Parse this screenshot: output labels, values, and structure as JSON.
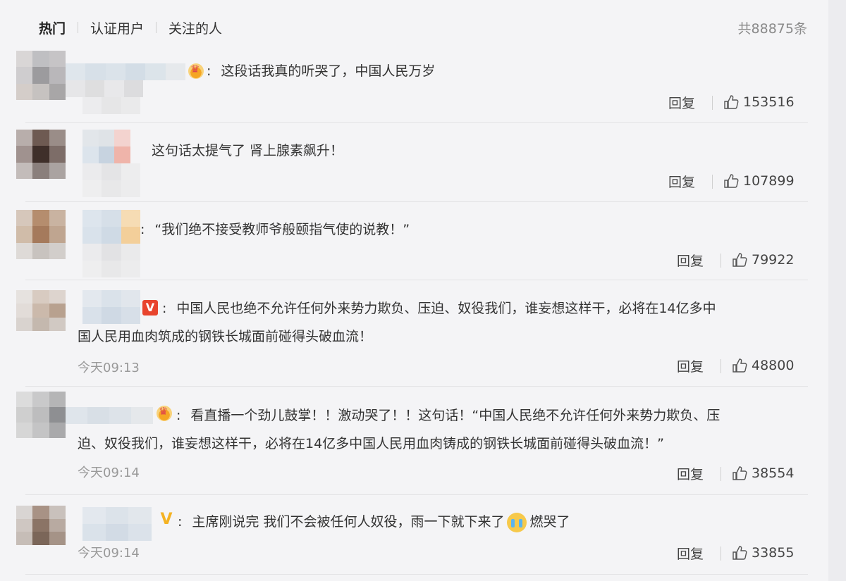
{
  "tabs": [
    {
      "label": "热门",
      "active": true
    },
    {
      "label": "认证用户",
      "active": false
    },
    {
      "label": "关注的人",
      "active": false
    }
  ],
  "total_count": "共88875条",
  "reply_label": "回复",
  "comments": [
    {
      "text": "这段话我真的听哭了，中国人民万岁",
      "badge": "crown",
      "likes": "153516",
      "time": ""
    },
    {
      "text": "这句话太提气了 肾上腺素飙升！",
      "badge": "none",
      "likes": "107899",
      "time": ""
    },
    {
      "text": "“我们绝不接受教师爷般颐指气使的说教！”",
      "badge": "crown",
      "likes": "79922",
      "time": ""
    },
    {
      "text_line1": "中国人民也绝不允许任何外来势力欺负、压迫、奴役我们，谁妄想这样干，必将在14亿多中",
      "text_line2": "国人民用血肉筑成的钢铁长城面前碰得头破血流！",
      "badge": "v-red",
      "likes": "48800",
      "time": "今天09:13"
    },
    {
      "text_line1": "看直播一个劲儿鼓掌！！激动哭了！！这句话！“中国人民绝不允许任何外来势力欺负、压",
      "text_line2": "迫、奴役我们，谁妄想这样干，必将在14亿多中国人民用血肉铸成的钢铁长城面前碰得头破血流！”",
      "badge": "crown",
      "likes": "38554",
      "time": "今天09:14"
    },
    {
      "text_a": "主席刚说完 我们不会被任何人奴役，雨一下就下来了",
      "text_b": "燃哭了",
      "badge": "v-gold",
      "likes": "33855",
      "time": "今天09:14"
    }
  ],
  "colors": {
    "accent_link": "#eb7350",
    "muted": "#999999"
  },
  "icons": [
    "thumbs-up-icon",
    "crown-badge-icon",
    "verified-v-icon",
    "crying-emoji-icon"
  ]
}
